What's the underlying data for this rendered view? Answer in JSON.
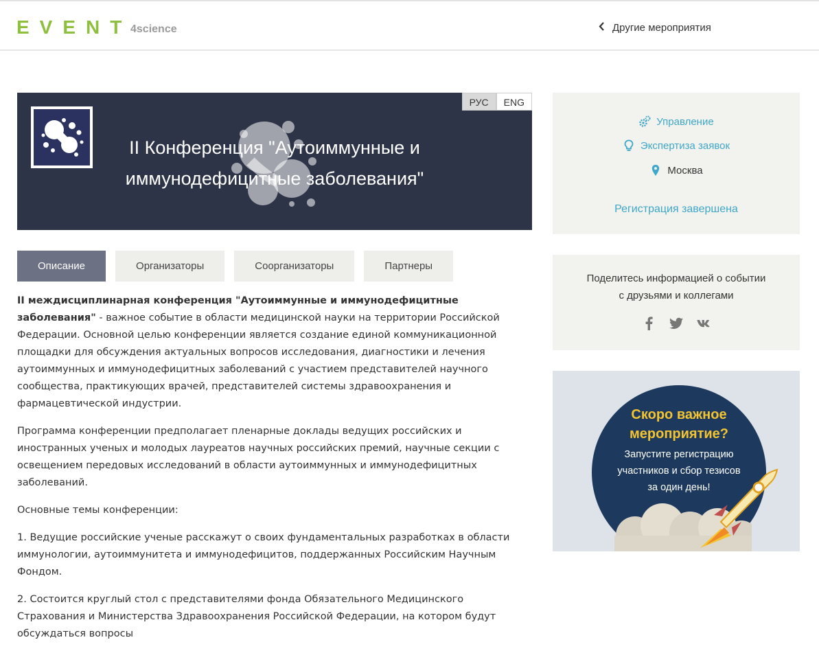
{
  "header": {
    "logo_main": "EVENT",
    "logo_sub": "4science",
    "other_events": "Другие мероприятия"
  },
  "banner": {
    "title_line1": "II Конференция \"Аутоиммунные и",
    "title_line2": "иммунодефицитные заболевания\"",
    "lang_ru": "РУС",
    "lang_en": "ENG"
  },
  "tabs": [
    {
      "label": "Описание",
      "active": true
    },
    {
      "label": "Организаторы",
      "active": false
    },
    {
      "label": "Соорганизаторы",
      "active": false
    },
    {
      "label": "Партнеры",
      "active": false
    }
  ],
  "description": {
    "p1_bold": "II междисциплинарная конференция \"Аутоиммунные и иммунодефицитные заболевания\"",
    "p1_rest": " - важное событие в области медицинской науки на территории Российской Федерации. Основной целью конференции является создание единой коммуникационной площадки для обсуждения актуальных вопросов исследования, диагностики и лечения аутоиммунных и иммунодефицитных заболеваний с участием представителей научного сообщества, практикующих врачей, представителей системы здравоохранения и фармацевтической индустрии.",
    "p2": "Программа конференции предполагает пленарные доклады ведущих российских и иностранных ученых и молодых лауреатов научных российских премий, научные секции с освещением передовых исследований в области аутоиммунных и иммунодефицитных заболеваний.",
    "p3": "Основные темы конференции:",
    "p4": "1. Ведущие российские ученые расскажут о своих фундаментальных разработках в области иммунологии, аутоиммунитета и иммунодефицитов, поддержанных Российским Научным Фондом.",
    "p5": "2. Состоится круглый стол с представителями фонда Обязательного Медицинского Страхования и Министерства Здравоохранения Российской Федерации, на котором будут обсуждаться вопросы"
  },
  "sidebar": {
    "manage": "Управление",
    "expertise": "Экспертиза заявок",
    "city": "Москва",
    "registration_status": "Регистрация завершена",
    "share_line1": "Поделитесь информацией о событии",
    "share_line2": "с друзьями и коллегами",
    "promo_title_line1": "Скоро важное",
    "promo_title_line2": "мероприятие?",
    "promo_text_line1": "Запустите регистрацию",
    "promo_text_line2": "участников и сбор тезисов",
    "promo_text_line3": "за один день!"
  },
  "colors": {
    "brand_green": "#8fbf3f",
    "link_blue": "#3fa7c7",
    "banner_bg": "#2e3448",
    "tab_active": "#6c7183",
    "promo_yellow": "#f4c430"
  },
  "icons": {
    "back": "chevron-left-icon",
    "manage": "gears-icon",
    "expertise": "lightbulb-icon",
    "city": "map-pin-icon",
    "share": [
      "facebook-icon",
      "twitter-icon",
      "vk-icon"
    ]
  }
}
